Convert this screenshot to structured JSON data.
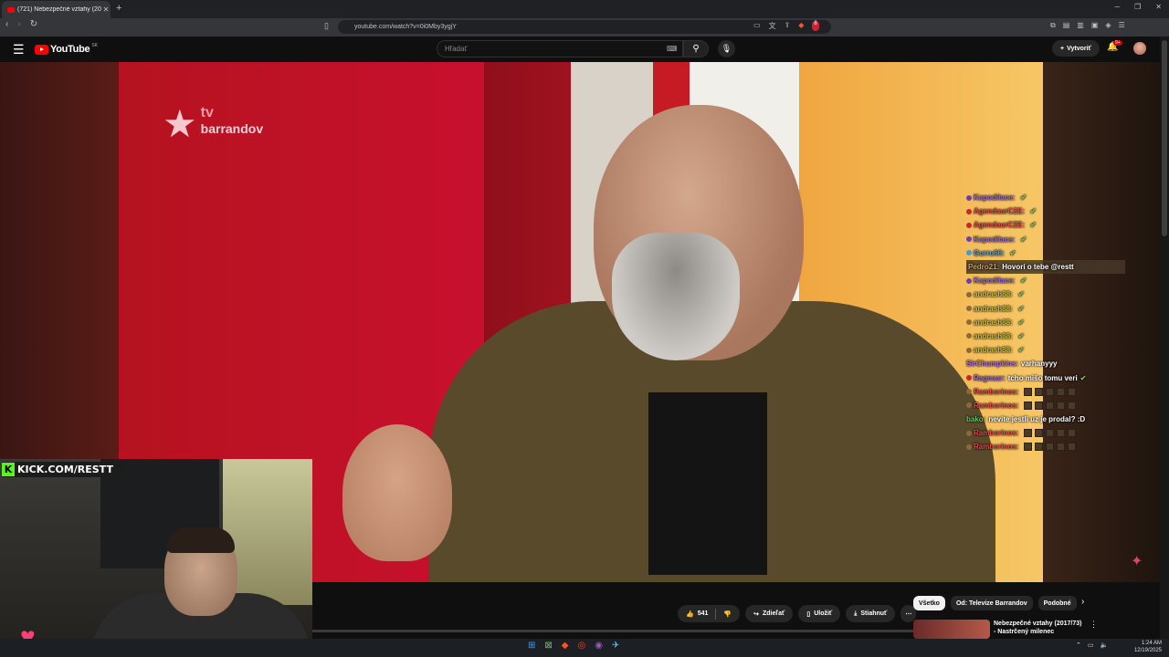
{
  "browser": {
    "tab_title": "(721) Nebezpečné vztahy (20",
    "url": "youtube.com/watch?v=0i0Mby3ygjY",
    "extension_badge": "8"
  },
  "youtube": {
    "logo_text": "YouTube",
    "region": "SK",
    "search_placeholder": "Hľadať",
    "create_label": "Vytvoriť",
    "notification_count": "9+"
  },
  "video": {
    "channel_logo_tv": "tv",
    "channel_logo_brand": "barrandov"
  },
  "overlay": {
    "kick_label": "KICK.COM/RESTT"
  },
  "chat": [
    {
      "name": "Kapodilace:",
      "color": "#9a6bd6",
      "badge": "#6a3fb5",
      "message": "",
      "check": true
    },
    {
      "name": "AgendaurCZE:",
      "color": "#e5484d",
      "badge": "#cc2233",
      "message": "",
      "check": true
    },
    {
      "name": "AgendaurCZE:",
      "color": "#e5484d",
      "badge": "#cc2233",
      "message": "",
      "check": true
    },
    {
      "name": "Kapodilace:",
      "color": "#9a6bd6",
      "badge": "#6a3fb5",
      "message": "",
      "check": true
    },
    {
      "name": "Gurru66:",
      "color": "#4aa3e8",
      "badge": "#3aa0d8",
      "message": "",
      "check": true
    },
    {
      "name": "Pedro21:",
      "color": "#c8a06a",
      "badge": "",
      "message": "Hovori o tebe @restt",
      "check": false,
      "highlight": true
    },
    {
      "name": "Kapodilace:",
      "color": "#9a6bd6",
      "badge": "#6a3fb5",
      "message": "",
      "check": true
    },
    {
      "name": "andrash88:",
      "color": "#c8c04a",
      "badge": "#8a6a3a",
      "message": "",
      "check": true
    },
    {
      "name": "andrash88:",
      "color": "#c8c04a",
      "badge": "#8a6a3a",
      "message": "",
      "check": true
    },
    {
      "name": "andrash88:",
      "color": "#c8c04a",
      "badge": "#8a6a3a",
      "message": "",
      "check": true
    },
    {
      "name": "andrash88:",
      "color": "#c8c04a",
      "badge": "#8a6a3a",
      "message": "",
      "check": true
    },
    {
      "name": "andrash88:",
      "color": "#c8c04a",
      "badge": "#8a6a3a",
      "message": "",
      "check": true
    },
    {
      "name": "SirChumpkins:",
      "color": "#b06be0",
      "badge": "",
      "message": "varhanyyy",
      "check": false
    },
    {
      "name": "Ragnaar:",
      "color": "#9a6bd6",
      "badge": "#cc2233",
      "message": "tcho mišo tomu veri",
      "check": true
    },
    {
      "name": "Ramborinos:",
      "color": "#e5484d",
      "badge": "#8a6a3a",
      "message": "",
      "check": false,
      "emotes": 5
    },
    {
      "name": "Ramborinos:",
      "color": "#e5484d",
      "badge": "#8a6a3a",
      "message": "",
      "check": false,
      "emotes": 5
    },
    {
      "name": "bako:",
      "color": "#6ac36b",
      "badge": "",
      "message": "nevite jestli uz je prodal? :D",
      "check": false
    },
    {
      "name": "Ramborinos:",
      "color": "#e5484d",
      "badge": "#8a6a3a",
      "message": "",
      "check": false,
      "emotes": 5
    },
    {
      "name": "Ramborinos:",
      "color": "#e5484d",
      "badge": "#8a6a3a",
      "message": "",
      "check": false,
      "emotes": 5
    }
  ],
  "actions": {
    "like_count": "541",
    "share": "Zdieľať",
    "save": "Uložiť",
    "download": "Stiahnuť"
  },
  "chips": [
    "Všetko",
    "Od: Televize Barrandov",
    "Podobné"
  ],
  "recommendation": {
    "title": "Nebezpečné vztahy (2017/73) - Nastrčený milenec"
  },
  "taskbar": {
    "time": "1:24 AM",
    "date": "12/19/2025"
  },
  "colors": {
    "youtube_red": "#ff0000",
    "kick_green": "#53fc18",
    "barrandov_red": "#c8102e"
  }
}
